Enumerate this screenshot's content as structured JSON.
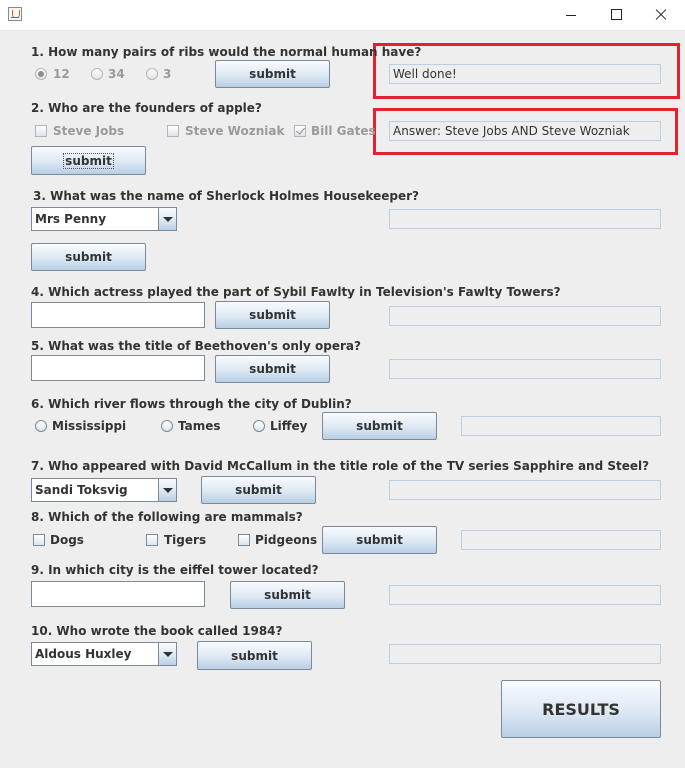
{
  "window": {
    "minimize": "",
    "maximize": "",
    "close": ""
  },
  "q1": {
    "question": "1. How many pairs of ribs would the normal human have?",
    "options": [
      "12",
      "34",
      "3"
    ],
    "submit": "submit",
    "feedback": "Well done!"
  },
  "q2": {
    "question": "2. Who are the founders of apple?",
    "options": [
      "Steve Jobs",
      "Steve Wozniak",
      "Bill Gates"
    ],
    "submit": "submit",
    "feedback": "Answer: Steve Jobs AND Steve Wozniak"
  },
  "q3": {
    "question": "3. What was the name of Sherlock Holmes Housekeeper?",
    "selected": "Mrs Penny",
    "submit": "submit",
    "feedback": ""
  },
  "q4": {
    "question": "4. Which actress played the part of Sybil Fawlty in Television's Fawlty Towers?",
    "answer": "",
    "submit": "submit",
    "feedback": ""
  },
  "q5": {
    "question": "5. What was the title of Beethoven's only opera?",
    "answer": "",
    "submit": "submit",
    "feedback": ""
  },
  "q6": {
    "question": "6. Which river flows through the city of Dublin?",
    "options": [
      "Mississippi",
      "Tames",
      "Liffey"
    ],
    "submit": "submit",
    "feedback": ""
  },
  "q7": {
    "question": "7. Who appeared with David McCallum in the title role of the TV series Sapphire and Steel?",
    "selected": "Sandi Toksvig",
    "submit": "submit",
    "feedback": ""
  },
  "q8": {
    "question": "8. Which of the following are mammals?",
    "options": [
      "Dogs",
      "Tigers",
      "Pidgeons"
    ],
    "submit": "submit",
    "feedback": ""
  },
  "q9": {
    "question": "9. In which city is the eiffel tower located?",
    "answer": "",
    "submit": "submit",
    "feedback": ""
  },
  "q10": {
    "question": "10. Who wrote the book called 1984?",
    "selected": "Aldous Huxley",
    "submit": "submit",
    "feedback": ""
  },
  "results": "RESULTS",
  "colors": {
    "highlight": "#e0232e",
    "button_top": "#f8fbfe",
    "button_bottom": "#b8cfe5",
    "background": "#eeeeee"
  }
}
